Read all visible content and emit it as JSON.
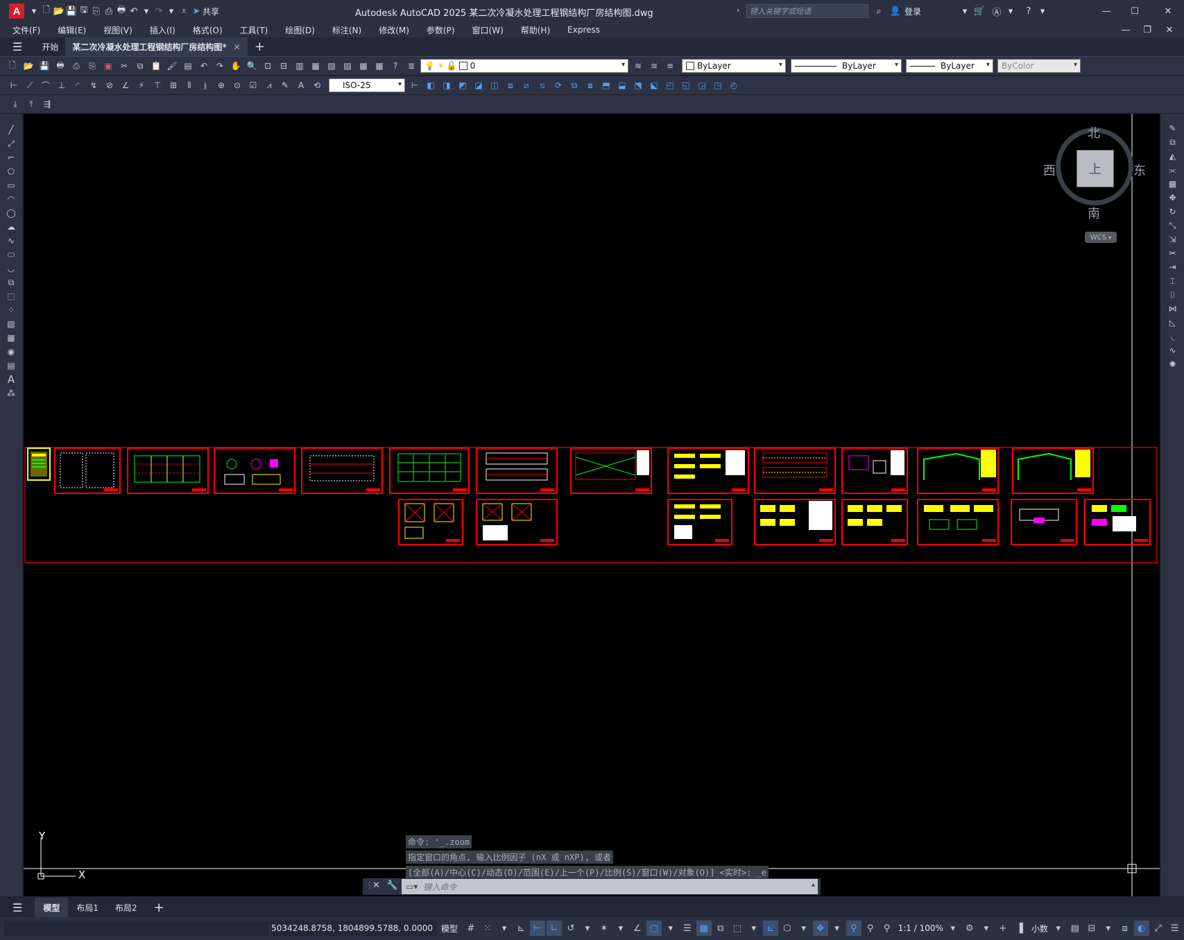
{
  "app": {
    "logo_letter": "A",
    "window_title": "Autodesk AutoCAD 2025    某二次冷凝水处理工程钢结构厂房结构图.dwg",
    "share_label": "共享",
    "search_placeholder": "键入关键字或短语",
    "login_label": "登录"
  },
  "menu": [
    "文件(F)",
    "编辑(E)",
    "视图(V)",
    "插入(I)",
    "格式(O)",
    "工具(T)",
    "绘图(D)",
    "标注(N)",
    "修改(M)",
    "参数(P)",
    "窗口(W)",
    "帮助(H)",
    "Express"
  ],
  "tabs": {
    "start": "开始",
    "document": "某二次冷凝水处理工程钢结构厂房结构图*"
  },
  "properties": {
    "layer": "0",
    "color": "ByLayer",
    "linetype": "ByLayer",
    "lineweight": "ByLayer",
    "plotstyle": "ByColor",
    "dimstyle": "ISO-25"
  },
  "viewcube": {
    "north": "北",
    "south": "南",
    "east": "东",
    "west": "西",
    "face": "上",
    "wcs": "WCS"
  },
  "ucs": {
    "x": "X",
    "y": "Y"
  },
  "command": {
    "history": [
      "命令: '_.zoom",
      "指定窗口的角点, 输入比例因子 (nX 或 nXP), 或者",
      "[全部(A)/中心(C)/动态(D)/范围(E)/上一个(P)/比例(S)/窗口(W)/对象(O)] <实时>: _e"
    ],
    "input_placeholder": "键入命令"
  },
  "layout_tabs": [
    "模型",
    "布局1",
    "布局2"
  ],
  "status": {
    "coords": "5034248.8758, 1804899.5788, 0.0000",
    "model": "模型",
    "scale": "1:1 / 100%",
    "units": "小数"
  },
  "colors": {
    "frame_red": "#ff0000",
    "drawing_green": "#00ff00",
    "drawing_yellow": "#ffff00",
    "drawing_magenta": "#ff00ff",
    "accent_blue": "#5aa0f0"
  }
}
